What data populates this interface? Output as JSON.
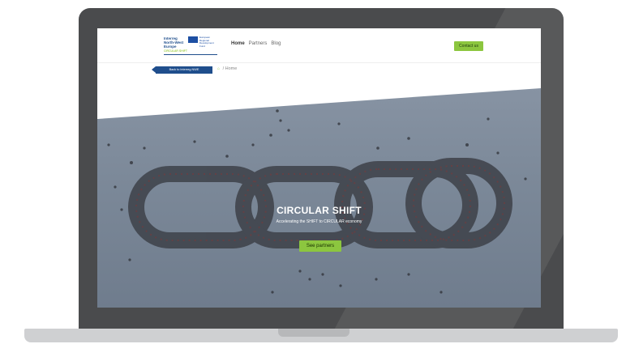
{
  "navbar": {
    "logo_text": "Interreg\nNorth-West Europe",
    "logo_sub": "CIRCULAR SHIFT",
    "eu_text": "European Regional Development Fund",
    "links": [
      {
        "label": "Home"
      },
      {
        "label": "Partners"
      },
      {
        "label": "Blog"
      }
    ],
    "contact_label": "Contact us"
  },
  "subbar": {
    "back_label": "Back to Interreg NWE",
    "breadcrumb": "/ Home"
  },
  "hero": {
    "title": "CIRCULAR SHIFT",
    "subtitle": "Accelerating the SHIFT to CIRCULAR economy",
    "button_label": "See partners"
  },
  "colors": {
    "accent": "#8cc63f",
    "brand": "#1f4e8c",
    "device_frame": "#4a4b4d"
  },
  "icons": [
    "home-icon",
    "eu-flag-icon",
    "back-arrow-icon"
  ]
}
